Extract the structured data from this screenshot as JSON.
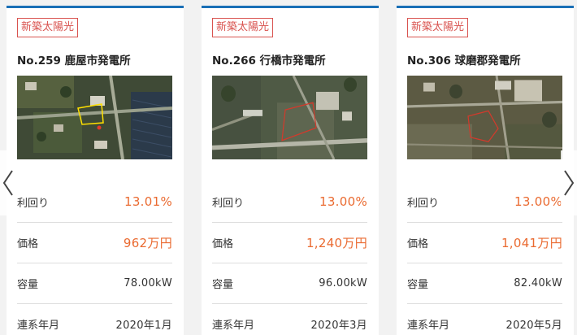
{
  "colors": {
    "accent_top": "#1a6fb6",
    "badge": "#d9534f",
    "value_accent": "#ea6a30"
  },
  "carousel": {
    "prev_icon": "chevron-left-icon",
    "next_icon": "chevron-right-icon"
  },
  "cards": [
    {
      "badge": "新築太陽光",
      "title": "No.259 鹿屋市発電所",
      "rows": [
        {
          "label": "利回り",
          "value": "13.01%"
        },
        {
          "label": "価格",
          "value": "962万円"
        },
        {
          "label": "容量",
          "value": "78.00kW"
        },
        {
          "label": "連系年月",
          "value": "2020年1月"
        }
      ]
    },
    {
      "badge": "新築太陽光",
      "title": "No.266 行橋市発電所",
      "rows": [
        {
          "label": "利回り",
          "value": "13.00%"
        },
        {
          "label": "価格",
          "value": "1,240万円"
        },
        {
          "label": "容量",
          "value": "96.00kW"
        },
        {
          "label": "連系年月",
          "value": "2020年3月"
        }
      ]
    },
    {
      "badge": "新築太陽光",
      "title": "No.306 球磨郡発電所",
      "rows": [
        {
          "label": "利回り",
          "value": "13.00%"
        },
        {
          "label": "価格",
          "value": "1,041万円"
        },
        {
          "label": "容量",
          "value": "82.40kW"
        },
        {
          "label": "連系年月",
          "value": "2020年5月"
        }
      ]
    }
  ]
}
